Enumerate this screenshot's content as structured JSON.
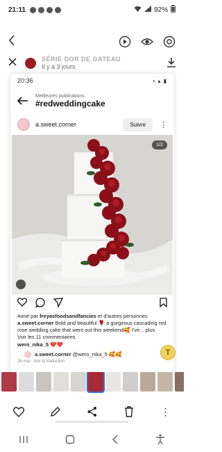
{
  "status_bar": {
    "time": "21:11",
    "battery": "92%"
  },
  "story": {
    "title": "SÉRIE DOR DE GATEAU",
    "age": "Il y a 3 jours"
  },
  "inner": {
    "time": "20:36",
    "header_sub": "Meilleures publications",
    "hashtag": "#redweddingcake",
    "user": "a.sweet.corner",
    "follow": "Suivre",
    "page_indicator": "1/2",
    "liked_prefix": "Aimé par",
    "liked_user": "freyasfoodsandfancies",
    "liked_suffix": "et d'autres personnes",
    "caption_user": "a.sweet.corner",
    "caption_text": "Bold and beautiful 🌹 a gorgeous cascading red rose wedding cake that went out this weekend🥰 I've... plus",
    "view_comments": "Voir les 11 commentaires",
    "comment_user": "wero_nika_5",
    "comment_text": "❤️❤️",
    "reply_user": "a.sweet.corner",
    "reply_text": "@wero_nika_5 🥰🥰",
    "reply_meta": "26 mai · Voir la traduction"
  },
  "colors": {
    "accent": "#2f6fdf",
    "rose": "#9c1c24"
  }
}
